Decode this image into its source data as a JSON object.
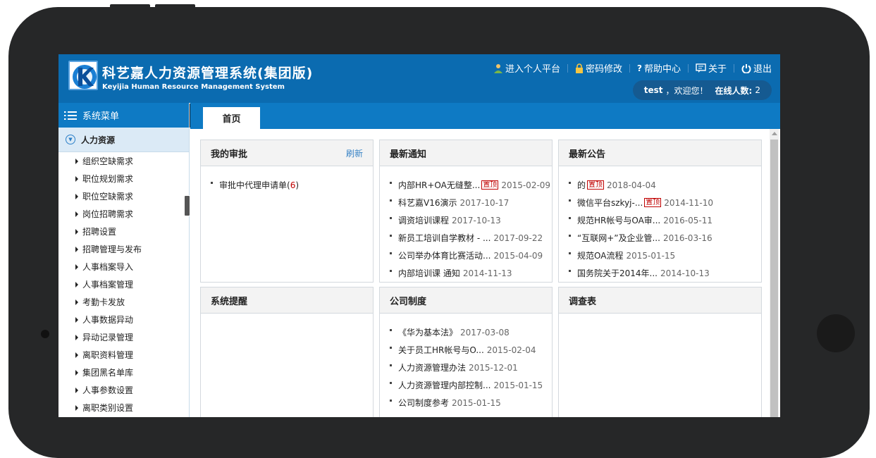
{
  "brand": {
    "logo_letter": "K",
    "title": "科艺嘉人力资源管理系统(集团版)",
    "subtitle": "Keyijia Human Resource Management System"
  },
  "toplinks": [
    {
      "icon": "user-icon",
      "label": "进入个人平台"
    },
    {
      "icon": "lock-icon",
      "label": "密码修改"
    },
    {
      "icon": "help-icon",
      "label": "帮助中心"
    },
    {
      "icon": "about-icon",
      "label": "关于"
    },
    {
      "icon": "power-icon",
      "label": "退出"
    }
  ],
  "userbar": {
    "username": "test",
    "welcome": "，欢迎您！",
    "online_label": "在线人数:",
    "online_count": "2"
  },
  "sidebar": {
    "header": "系统菜单",
    "group": "人力资源",
    "items": [
      "组织空缺需求",
      "职位规划需求",
      "职位空缺需求",
      "岗位招聘需求",
      "招聘设置",
      "招聘管理与发布",
      "人事档案导入",
      "人事档案管理",
      "考勤卡发放",
      "人事数据异动",
      "异动记录管理",
      "离职资料管理",
      "集团黑名单库",
      "人事参数设置",
      "离职类别设置"
    ]
  },
  "tabs": [
    "首页"
  ],
  "panels": {
    "approval": {
      "title": "我的审批",
      "refresh": "刷新",
      "items": [
        {
          "text": "审批中代理申请单(",
          "count": "6",
          "close": ")"
        }
      ]
    },
    "notice": {
      "title": "最新通知",
      "badge": "置顶",
      "items": [
        {
          "text": "内部HR+OA无缝整...",
          "top": true,
          "date": "2015-02-09"
        },
        {
          "text": "科艺嘉V16演示",
          "top": false,
          "date": "2017-10-17"
        },
        {
          "text": "调资培训课程",
          "top": false,
          "date": "2017-10-13"
        },
        {
          "text": "新员工培训自学教材 - ...",
          "top": false,
          "date": "2017-09-22"
        },
        {
          "text": "公司举办体育比赛活动...",
          "top": false,
          "date": "2015-04-09"
        },
        {
          "text": "内部培训课 通知",
          "top": false,
          "date": "2014-11-13"
        }
      ]
    },
    "announce": {
      "title": "最新公告",
      "badge": "置顶",
      "items": [
        {
          "text": "的",
          "top": true,
          "date": "2018-04-04"
        },
        {
          "text": "微信平台szkyj-...",
          "top": true,
          "date": "2014-11-10"
        },
        {
          "text": "规范HR帐号与OA审...",
          "top": false,
          "date": "2016-05-11"
        },
        {
          "text": "“互联网+”及企业管...",
          "top": false,
          "date": "2016-03-16"
        },
        {
          "text": "规范OA流程",
          "top": false,
          "date": "2015-01-15"
        },
        {
          "text": "国务院关于2014年...",
          "top": false,
          "date": "2014-10-13"
        }
      ]
    },
    "reminder": {
      "title": "系统提醒",
      "items": []
    },
    "policy": {
      "title": "公司制度",
      "items": [
        {
          "text": "《华为基本法》",
          "date": "2017-03-08"
        },
        {
          "text": "关于员工HR帐号与O...",
          "date": "2015-02-04"
        },
        {
          "text": "人力资源管理办法",
          "date": "2015-12-01"
        },
        {
          "text": "人力资源管理内部控制...",
          "date": "2015-01-15"
        },
        {
          "text": "公司制度参考",
          "date": "2015-01-15"
        }
      ]
    },
    "survey": {
      "title": "调查表",
      "items": []
    }
  }
}
